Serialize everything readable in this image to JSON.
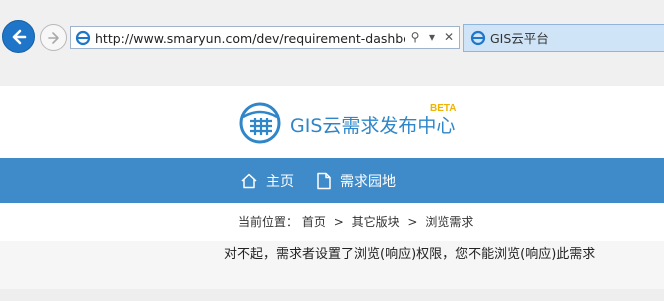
{
  "browser": {
    "url": "http://www.smaryun.com/dev/requirement-dashboard",
    "tab_title": "GIS云平台",
    "search_glyph": "⚲",
    "dropdown_glyph": "▾",
    "close_glyph": "✕"
  },
  "header": {
    "logo_text": "GIS云需求发布中心",
    "beta_label": "BETA"
  },
  "nav": {
    "items": [
      {
        "label": "主页",
        "icon": "home-icon"
      },
      {
        "label": "需求园地",
        "icon": "document-icon"
      }
    ]
  },
  "breadcrumb": {
    "prefix": "当前位置：",
    "items": [
      "首页",
      "其它版块",
      "浏览需求"
    ],
    "separator": ">"
  },
  "content": {
    "message": "对不起，需求者设置了浏览(响应)权限，您不能浏览(响应)此需求"
  },
  "colors": {
    "brand_blue": "#2f86c8",
    "nav_blue": "#3f8bc9",
    "beta_yellow": "#f0b400"
  }
}
